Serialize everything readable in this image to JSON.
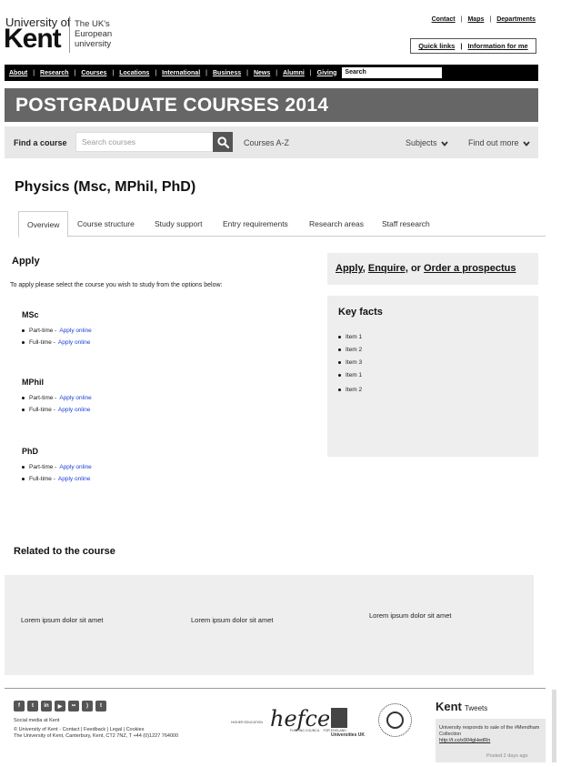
{
  "header": {
    "logo_university_of": "University of",
    "logo_kent": "Kent",
    "logo_tagline": [
      "The UK's",
      "European",
      "university"
    ],
    "top_links": [
      "Contact",
      "Maps",
      "Departments"
    ],
    "quick_links": "Quick links",
    "information_for_me": "Information for me"
  },
  "nav": {
    "items": [
      "About",
      "Research",
      "Courses",
      "Locations",
      "International",
      "Business",
      "News",
      "Alumni",
      "Giving"
    ],
    "search_value": "Search"
  },
  "banner": {
    "title": "POSTGRADUATE COURSES 2014"
  },
  "find": {
    "label": "Find a course",
    "placeholder": "Search courses",
    "courses_az": "Courses A-Z",
    "subjects": "Subjects",
    "find_out_more": "Find out more"
  },
  "page": {
    "title": "Physics (Msc, MPhil, PhD)"
  },
  "tabs": [
    {
      "label": "Overview"
    },
    {
      "label": "Course structure"
    },
    {
      "label": "Study support"
    },
    {
      "label": "Entry requirements"
    },
    {
      "label": "Research areas"
    },
    {
      "label": "Staff research"
    }
  ],
  "apply": {
    "heading": "Apply",
    "intro": "To apply please select the course you wish to study from the options below:",
    "degrees": [
      {
        "name": "MSc",
        "options": [
          {
            "mode": "Part-time",
            "link": "Apply online"
          },
          {
            "mode": "Full-time",
            "link": "Apply online"
          }
        ]
      },
      {
        "name": "MPhil",
        "options": [
          {
            "mode": "Part-time",
            "link": "Apply online"
          },
          {
            "mode": "Full-time",
            "link": "Apply online"
          }
        ]
      },
      {
        "name": "PhD",
        "options": [
          {
            "mode": "Part-time",
            "link": "Apply online"
          },
          {
            "mode": "Full-time",
            "link": "Apply online"
          }
        ]
      }
    ]
  },
  "cta": {
    "apply": "Apply",
    "enquire": "Enquire,",
    "or": "or",
    "order": "Order a prospectus"
  },
  "key_facts": {
    "title": "Key facts",
    "items": [
      "Item 1",
      "Item 2",
      "Item 3",
      "Item 1",
      "Item 2"
    ]
  },
  "related": {
    "heading": "Related to the course",
    "items": [
      "Lorem ipsum dolor sit amet",
      "Lorem ipsum dolor sit amet",
      "Lorem ipsum dolor sit amet"
    ]
  },
  "footer": {
    "social_label": "Social media at Kent",
    "copyright_line1": "© University of Kent - Contact | Feedback | Legal | Cookies",
    "copyright_line2": "The University of Kent, Canterbury, Kent, CT2 7NZ, T +44 (0)1227 764000",
    "hefce": "hefce",
    "hefce_left": "HIGHER EDUCATION",
    "hefce_bottom_left": "FUNDING COUNCIL",
    "hefce_bottom_right": "FOR ENGLAND",
    "uuk": "Universities UK",
    "tweets_kent": "Kent",
    "tweets_label": "Tweets",
    "tweet_text": "University responds to sale of the #Mendham Collection",
    "tweet_link": "http://t.co/x904gHedRn",
    "tweet_time": "Posted 2 days ago"
  }
}
